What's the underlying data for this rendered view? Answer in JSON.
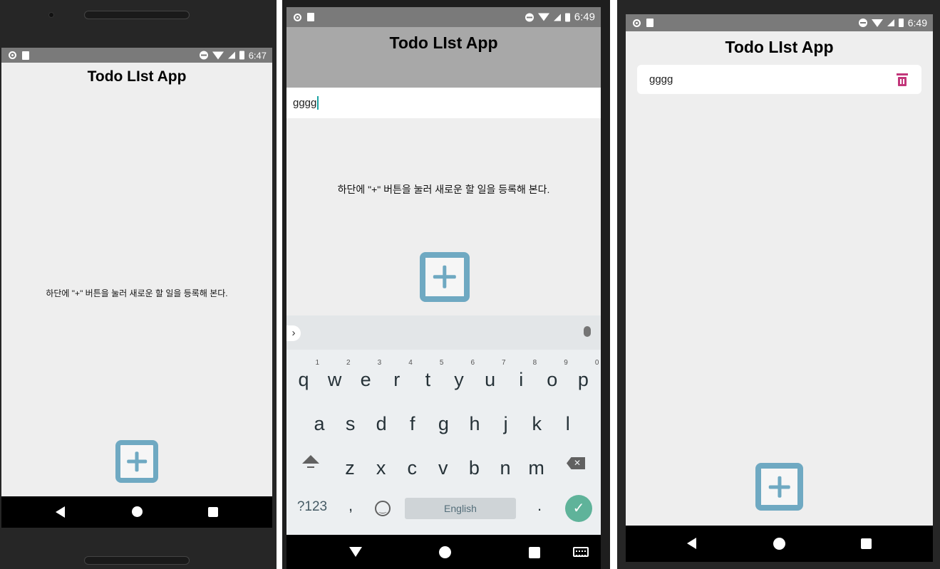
{
  "screens": [
    {
      "status_time": "6:47",
      "title": "Todo LIst App",
      "hint": "하단에 \"+\" 버튼을 눌러 새로운 할 일을 등록해 본다."
    },
    {
      "status_time": "6:49",
      "title": "Todo LIst App",
      "input_value": "gggg",
      "hint": "하단에 \"+\" 버튼을 눌러 새로운 할 일을 등록해 본다.",
      "keyboard": {
        "row1": [
          "q",
          "w",
          "e",
          "r",
          "t",
          "y",
          "u",
          "i",
          "o",
          "p"
        ],
        "row1_nums": [
          "1",
          "2",
          "3",
          "4",
          "5",
          "6",
          "7",
          "8",
          "9",
          "0"
        ],
        "row2": [
          "a",
          "s",
          "d",
          "f",
          "g",
          "h",
          "j",
          "k",
          "l"
        ],
        "row3": [
          "z",
          "x",
          "c",
          "v",
          "b",
          "n",
          "m"
        ],
        "symbols_label": "?123",
        "comma": ",",
        "period": ".",
        "space_label": "English"
      }
    },
    {
      "status_time": "6:49",
      "title": "Todo LIst App",
      "items": [
        {
          "text": "gggg"
        }
      ]
    }
  ],
  "colors": {
    "accent": "#6fa9c2",
    "trash": "#c2367a",
    "enter_key": "#5fb39a"
  },
  "icons": [
    "add-square-icon",
    "trash-icon",
    "back-icon",
    "home-icon",
    "recents-icon",
    "microphone-icon",
    "emoji-icon",
    "backspace-icon",
    "shift-icon",
    "check-icon",
    "keyboard-icon",
    "chevron-right-icon"
  ]
}
